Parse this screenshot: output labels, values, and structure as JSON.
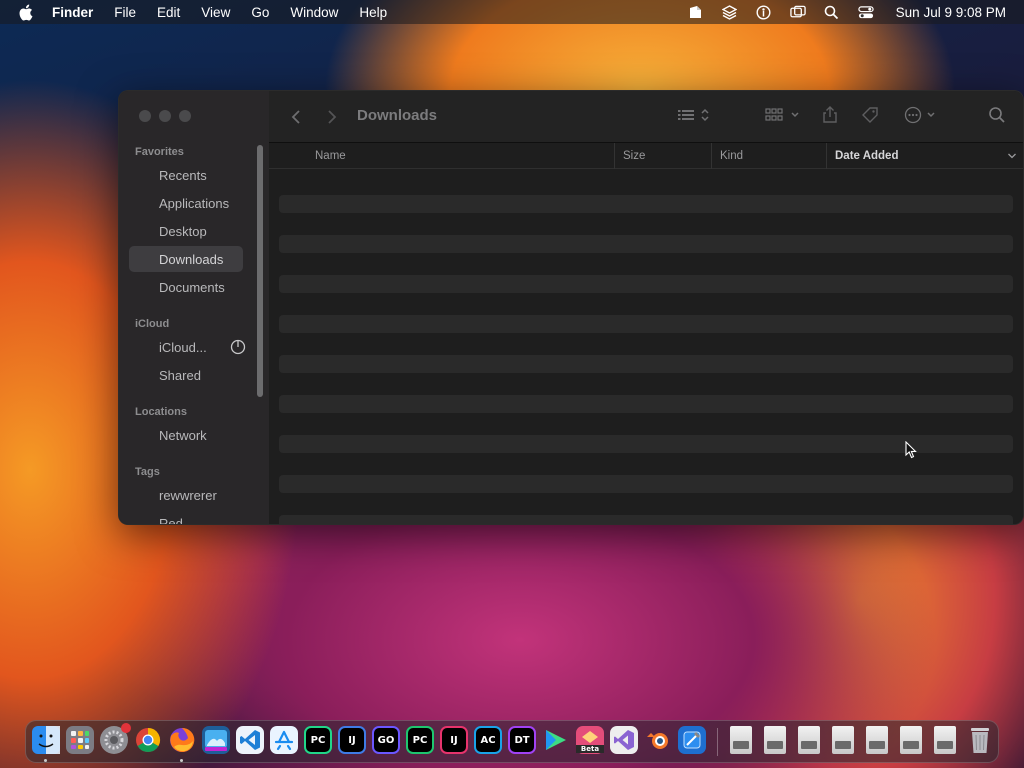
{
  "menubar": {
    "app_name": "Finder",
    "items": [
      "File",
      "Edit",
      "View",
      "Go",
      "Window",
      "Help"
    ],
    "clock": "Sun Jul 9  9:08 PM"
  },
  "window": {
    "title": "Downloads",
    "sidebar": {
      "favorites_label": "Favorites",
      "favorites": [
        "Recents",
        "Applications",
        "Desktop",
        "Downloads",
        "Documents"
      ],
      "active_item": "Downloads",
      "icloud_label": "iCloud",
      "icloud_items": [
        "iCloud...",
        "Shared"
      ],
      "locations_label": "Locations",
      "locations": [
        "Network"
      ],
      "tags_label": "Tags",
      "tags": [
        "rewwrerer",
        "Red"
      ]
    },
    "columns": [
      "Name",
      "Size",
      "Kind",
      "Date Added"
    ],
    "sorted_column": "Date Added"
  },
  "dock": {
    "apps": [
      {
        "name": "finder-icon",
        "label": "",
        "color": "#2b8cf0"
      },
      {
        "name": "launchpad-icon",
        "label": "",
        "color": "#8a8a90"
      },
      {
        "name": "system-settings-icon",
        "label": "",
        "color": "#8e8e93"
      },
      {
        "name": "chrome-icon",
        "label": "",
        "color": "#ffffff"
      },
      {
        "name": "firefox-icon",
        "label": "",
        "color": "#ff7a1a"
      },
      {
        "name": "preview-icon",
        "label": "",
        "color": "#3b9ad9"
      },
      {
        "name": "vscode-icon",
        "label": "",
        "color": "#1f7fd6"
      },
      {
        "name": "app-store-icon",
        "label": "",
        "color": "#ffffff"
      },
      {
        "name": "pycharm-icon",
        "label": "PC",
        "color": "#21d789"
      },
      {
        "name": "intellij-icon",
        "label": "IJ",
        "color": "#3f7be6"
      },
      {
        "name": "goland-icon",
        "label": "GO",
        "color": "#6b57ff"
      },
      {
        "name": "pycharm-ce-icon",
        "label": "PC",
        "color": "#1ec66f"
      },
      {
        "name": "intellij-ce-icon",
        "label": "IJ",
        "color": "#e7336c"
      },
      {
        "name": "appcode-icon",
        "label": "AC",
        "color": "#1aa3e8"
      },
      {
        "name": "datagrip-icon",
        "label": "DT",
        "color": "#a142f4"
      },
      {
        "name": "android-studio-icon",
        "label": "",
        "color": "#3ddc84"
      },
      {
        "name": "beta-app-icon",
        "label": "Beta",
        "color": "#e44d7a"
      },
      {
        "name": "visual-studio-icon",
        "label": "",
        "color": "#8a63d2"
      },
      {
        "name": "blender-icon",
        "label": "",
        "color": "#f5792a"
      },
      {
        "name": "xcode-icon",
        "label": "",
        "color": "#2c8ef0"
      }
    ]
  }
}
